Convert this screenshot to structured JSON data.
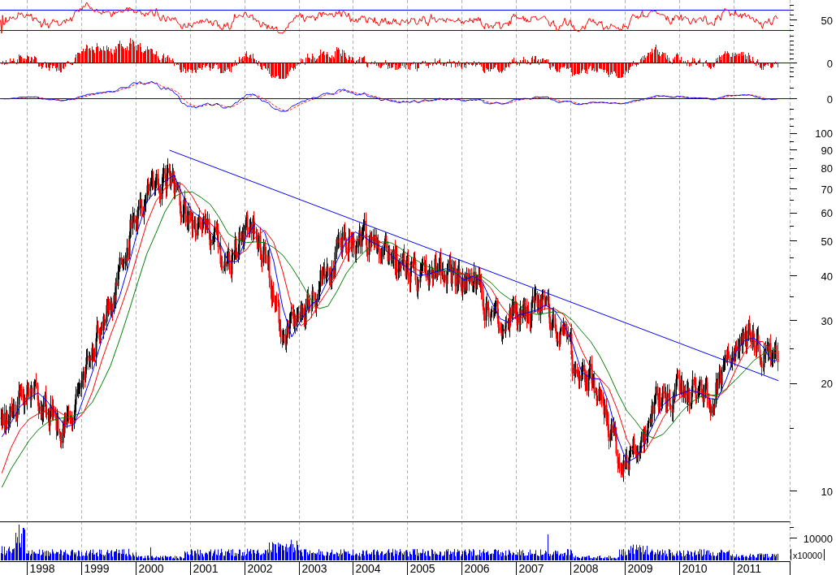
{
  "indicator_panels": [
    {
      "kind": "oscillator",
      "axis_label": "50"
    },
    {
      "kind": "histogram",
      "axis_label": "0"
    },
    {
      "kind": "macd",
      "axis_label": "0"
    }
  ],
  "price_chart": {
    "axis_labels": [
      "100",
      "90",
      "80",
      "70",
      "60",
      "50",
      "40",
      "30",
      "20",
      "10"
    ]
  },
  "volume_panel": {
    "axis_label": "10000",
    "unit": "x10000"
  },
  "x_axis": {
    "labels": [
      "1998",
      "1999",
      "2000",
      "2001",
      "2002",
      "2003",
      "2004",
      "2005",
      "2006",
      "2007",
      "2008",
      "2009",
      "2010",
      "2011"
    ]
  }
}
